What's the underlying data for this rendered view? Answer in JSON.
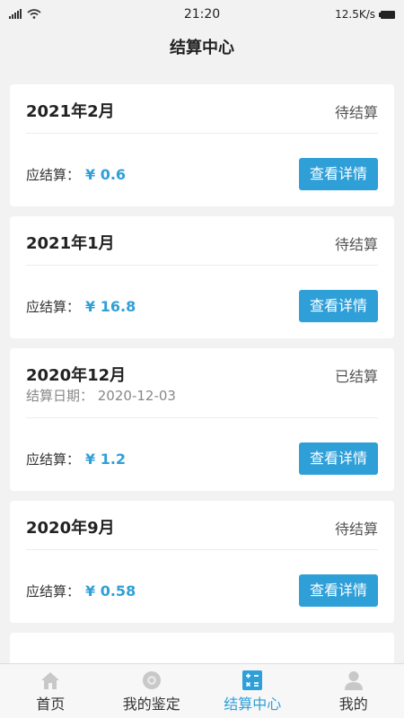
{
  "status_bar": {
    "time": "21:20",
    "speed": "12.5K/s"
  },
  "nav": {
    "title": "结算中心"
  },
  "cards": [
    {
      "period": "2021年2月",
      "status": "待结算",
      "amount_label": "应结算：",
      "amount": "¥ 0.6",
      "button_label": "查看详情"
    },
    {
      "period": "2021年1月",
      "status": "待结算",
      "amount_label": "应结算：",
      "amount": "¥ 16.8",
      "button_label": "查看详情"
    },
    {
      "period": "2020年12月",
      "status": "已结算",
      "settle_date": "结算日期：  2020-12-03",
      "amount_label": "应结算：",
      "amount": "¥ 1.2",
      "button_label": "查看详情"
    },
    {
      "period": "2020年9月",
      "status": "待结算",
      "amount_label": "应结算：",
      "amount": "¥ 0.58",
      "button_label": "查看详情"
    }
  ],
  "tab_bar": {
    "tabs": [
      {
        "label": "首页",
        "icon": "home-icon",
        "active": false
      },
      {
        "label": "我的鉴定",
        "icon": "appraisal-icon",
        "active": false
      },
      {
        "label": "结算中心",
        "icon": "calculator-icon",
        "active": true
      },
      {
        "label": "我的",
        "icon": "person-icon",
        "active": false
      }
    ]
  },
  "colors": {
    "accent": "#2f9fd8",
    "background": "#f2f2f2",
    "card": "#ffffff"
  }
}
